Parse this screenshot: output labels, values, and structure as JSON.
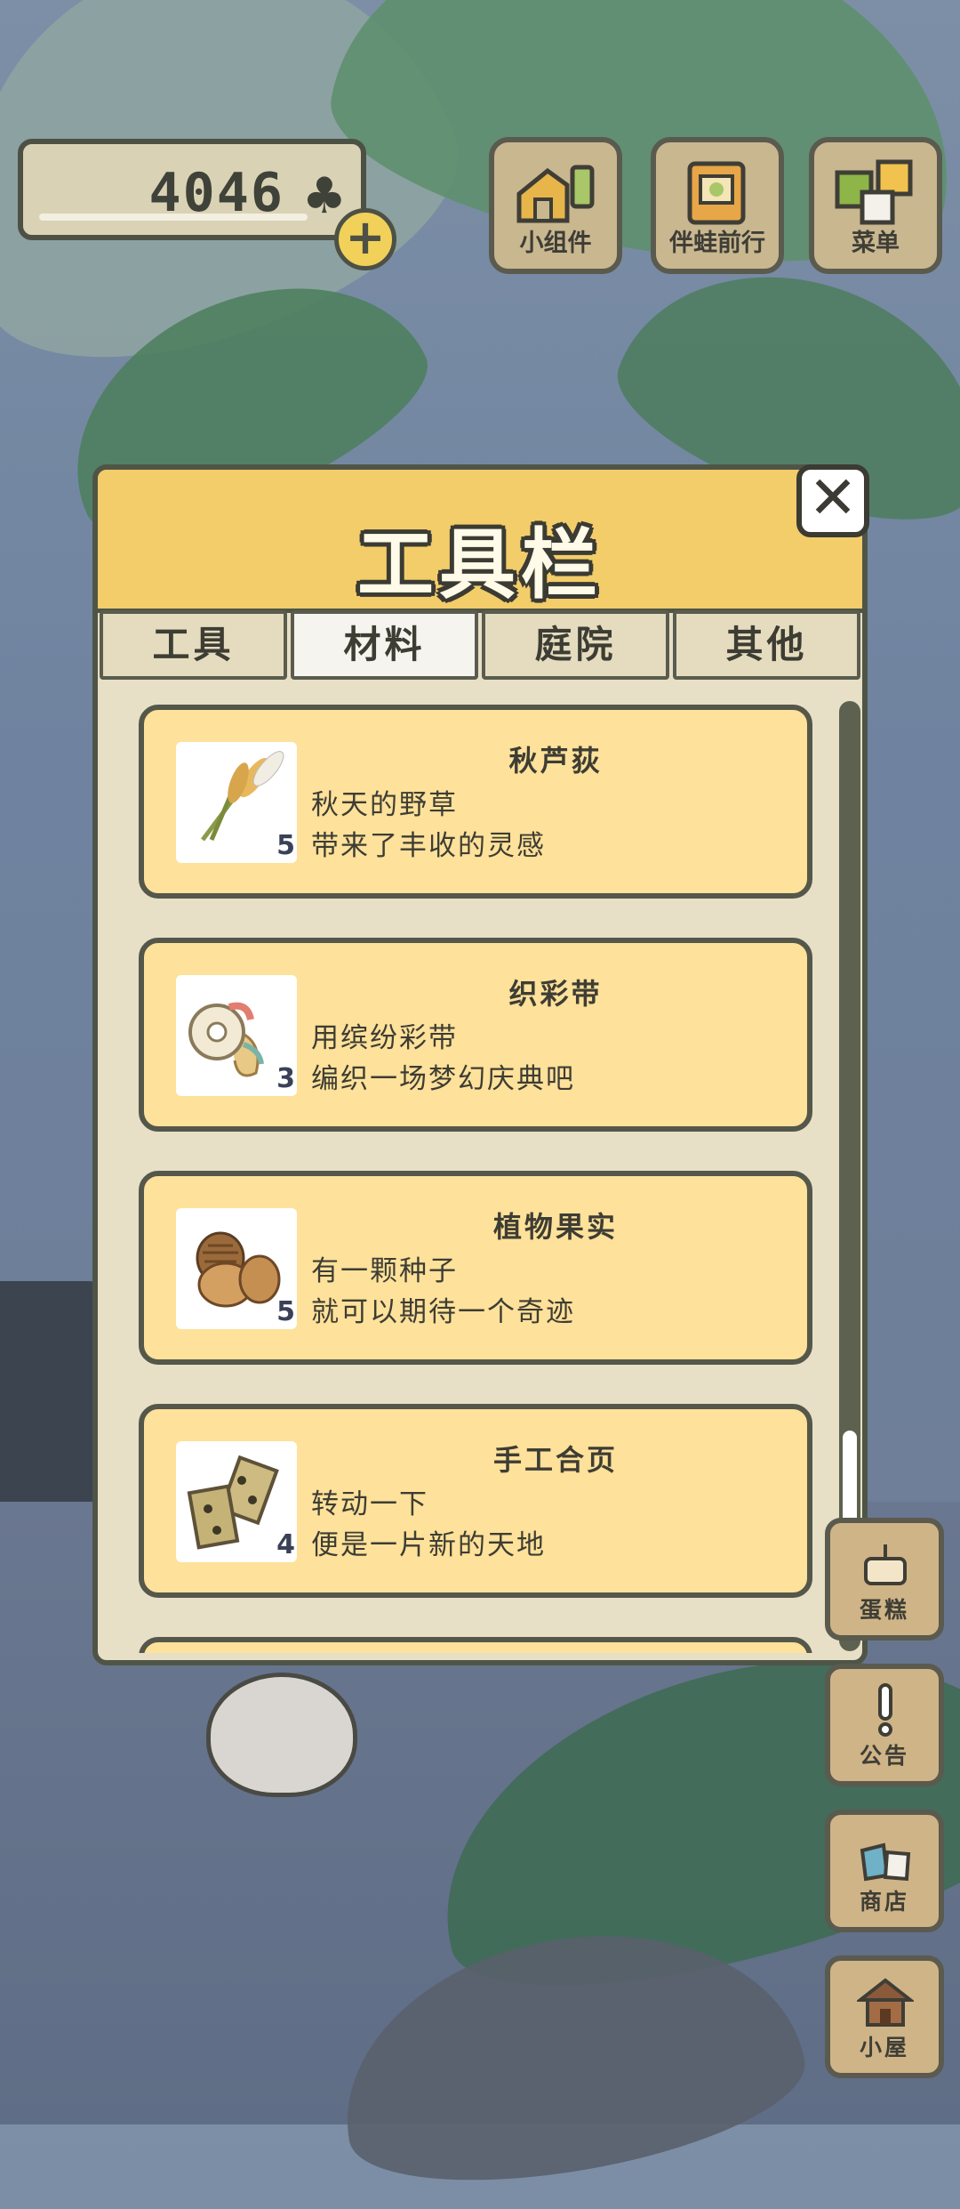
{
  "currency": {
    "value": "4046",
    "icon": "clover-icon"
  },
  "top_buttons": [
    {
      "label": "小组件",
      "icon": "widget-icon"
    },
    {
      "label": "伴蛙前行",
      "icon": "journal-icon"
    },
    {
      "label": "菜单",
      "icon": "menu-icon"
    }
  ],
  "panel": {
    "title": "工具栏",
    "close_label": "✕",
    "tabs": [
      "工具",
      "材料",
      "庭院",
      "其他"
    ],
    "active_tab": "材料"
  },
  "items": [
    {
      "name": "秋芦荻",
      "count": "5",
      "desc1": "秋天的野草",
      "desc2": "带来了丰收的灵感",
      "icon": "reed-icon"
    },
    {
      "name": "织彩带",
      "count": "3",
      "desc1": "用缤纷彩带",
      "desc2": "编织一场梦幻庆典吧",
      "icon": "ribbon-icon"
    },
    {
      "name": "植物果实",
      "count": "5",
      "desc1": "有一颗种子",
      "desc2": "就可以期待一个奇迹",
      "icon": "acorn-icon"
    },
    {
      "name": "手工合页",
      "count": "4",
      "desc1": "转动一下",
      "desc2": "便是一片新的天地",
      "icon": "hinge-icon"
    }
  ],
  "side_buttons": [
    {
      "label": "蛋糕",
      "icon": "cake-icon"
    },
    {
      "label": "公告",
      "icon": "exclamation-icon"
    },
    {
      "label": "商店",
      "icon": "shop-bags-icon"
    },
    {
      "label": "小屋",
      "icon": "house-icon"
    }
  ]
}
